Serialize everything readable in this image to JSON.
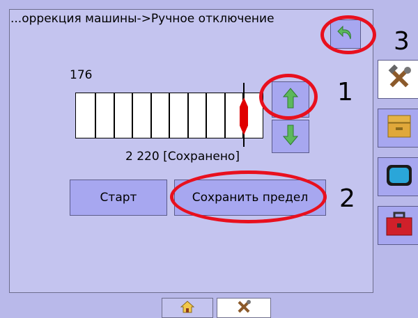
{
  "header": {
    "title": "...оррекция машины->Ручное отключение"
  },
  "gauge": {
    "top_value": "176",
    "bottom_value": "2  220 [Сохранено]",
    "tick_count": 9,
    "marker_position_fraction": 0.88
  },
  "buttons": {
    "start_label": "Старт",
    "save_limit_label": "Сохранить предел"
  },
  "annotations": {
    "label_1": "1",
    "label_2": "2",
    "label_3": "3",
    "color": "#e8101e"
  },
  "icons": {
    "back": "back-arrow-icon",
    "up": "up-arrow-icon",
    "down": "down-arrow-icon",
    "sidebar": [
      "tools-icon",
      "archive-icon",
      "monitor-icon",
      "toolbox-icon"
    ],
    "tabs": [
      "home-icon",
      "tools-icon"
    ]
  },
  "colors": {
    "background": "#b9b9ea",
    "panel": "#c4c4ef",
    "button": "#a7a7f0",
    "arrow_green": "#5cb85c",
    "marker_red": "#e00000"
  }
}
